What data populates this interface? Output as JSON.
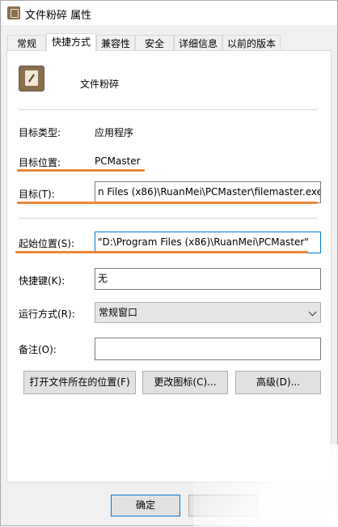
{
  "window": {
    "title": "文件粉碎 属性"
  },
  "tabs": [
    {
      "label": "常规"
    },
    {
      "label": "快捷方式"
    },
    {
      "label": "兼容性"
    },
    {
      "label": "安全"
    },
    {
      "label": "详细信息"
    },
    {
      "label": "以前的版本"
    }
  ],
  "active_tab": "快捷方式",
  "shortcut": {
    "name": "文件粉碎",
    "target_type_label": "目标类型:",
    "target_type_value": "应用程序",
    "target_location_label": "目标位置:",
    "target_location_value": "PCMaster",
    "target_label": "目标(T):",
    "target_value": "n Files (x86)\\RuanMei\\PCMaster\\filemaster.exe\"",
    "start_in_label": "起始位置(S):",
    "start_in_value": "\"D:\\Program Files (x86)\\RuanMei\\PCMaster\"",
    "hotkey_label": "快捷键(K):",
    "hotkey_value": "无",
    "run_label": "运行方式(R):",
    "run_value": "常规窗口",
    "comment_label": "备注(O):",
    "comment_value": ""
  },
  "buttons": {
    "open_location": "打开文件所在的位置(F)",
    "change_icon": "更改图标(C)...",
    "advanced": "高级(D)...",
    "ok": "确定"
  },
  "colors": {
    "annotation_underline": "#e8883a",
    "focus_border": "#0078d7"
  }
}
